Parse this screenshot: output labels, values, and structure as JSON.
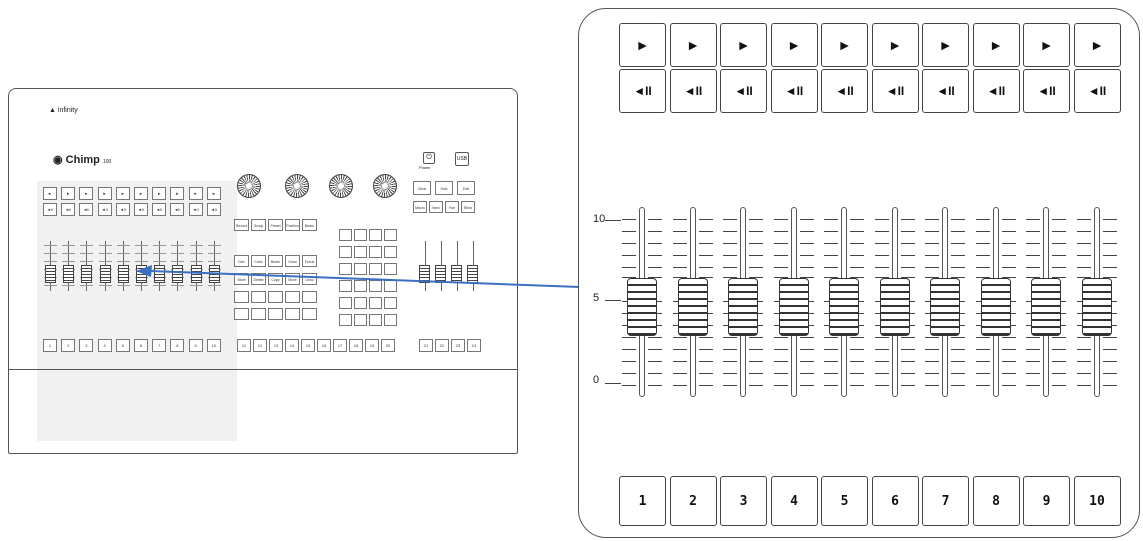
{
  "console": {
    "brand": "infinity",
    "model": "Chimp",
    "model_suffix": "100",
    "power_label": "Power",
    "usb_label": "USB",
    "flash_symbol": "►",
    "go_symbol": "◄II",
    "fader_numbers": [
      "1",
      "2",
      "3",
      "4",
      "5",
      "6",
      "7",
      "8",
      "9",
      "10"
    ],
    "keypad_row_labels": [
      [
        "Record",
        "Group",
        "Preset",
        "Position",
        "Beam"
      ],
      [
        "Dim",
        "Color",
        "Beam",
        "Gobo",
        "Focus"
      ],
      [
        "Store",
        "Delete",
        "Copy",
        "Move",
        "Undo"
      ]
    ],
    "right_key_labels": [
      "Clear",
      "Solo",
      "Edit"
    ],
    "right_small_labels": [
      "Macro",
      "Next",
      "Fan",
      "Blind"
    ],
    "bottom_labels": [
      "1",
      "2",
      "3",
      "4",
      "5",
      "6",
      "7",
      "8",
      "9",
      "10",
      "11",
      "12",
      "13",
      "14",
      "15",
      "16",
      "17",
      "18",
      "19",
      "20",
      "21",
      "22",
      "23",
      "24"
    ]
  },
  "zoom": {
    "flash_symbol": "►",
    "go_symbol": "◄II",
    "button_numbers": [
      "1",
      "2",
      "3",
      "4",
      "5",
      "6",
      "7",
      "8",
      "9",
      "10"
    ],
    "scale_labels": {
      "top": "10",
      "mid": "5",
      "bottom": "0"
    },
    "fader_count": 10,
    "fader_level": 0.5
  },
  "colors": {
    "arrow": "#3a6fc4",
    "outline": "#444444"
  },
  "icons": {
    "flash": "play-triangle-icon",
    "go": "go-back-pause-icon",
    "power": "power-icon",
    "usb": "usb-icon",
    "brand": "infinity-logo-icon",
    "model": "chimp-logo-icon"
  }
}
